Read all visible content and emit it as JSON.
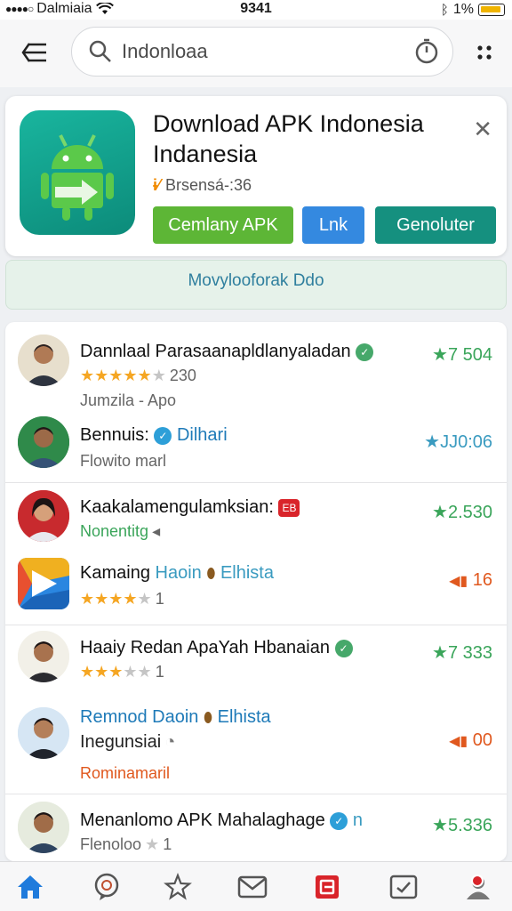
{
  "status_bar": {
    "carrier": "Dalmiaia",
    "time": "9341",
    "battery": "1%"
  },
  "search": {
    "value": "Indonloaa"
  },
  "featured": {
    "title": "Download APK Indonesia Indanesia",
    "meta": "Brsensá-:36",
    "buttons": {
      "primary": "Cemlany APK",
      "secondary": "Lnk",
      "tertiary": "Genoluter"
    },
    "colors": {
      "primary": "#5db636",
      "secondary": "#3489e0",
      "tertiary": "#15907f",
      "icon": "#19b59e"
    }
  },
  "banner": {
    "text": "Movylooforak Ddo"
  },
  "list": [
    {
      "title": "Dannlaal Parasaanapldlanyaladan",
      "stars": "★★★★★",
      "stars_off": "★",
      "rating_count": "230",
      "subtitle": "Jumzila - Apo",
      "value": "★7 504"
    },
    {
      "title": "Bennuis:",
      "title_accent": "Dilhari",
      "subtitle": "Flowito marl",
      "value": "★JJ0:06"
    },
    {
      "title": "Kaakalamengulamksian:",
      "tag": "EB",
      "subtitle": "Nonentitg",
      "value": "★2.530"
    },
    {
      "title": "Kamaing",
      "title_accent": "Haoin",
      "title_accent2": "Elhista",
      "stars": "★★★★",
      "stars_off": "★",
      "rating_count": "1",
      "value": "16"
    },
    {
      "title": "Haaiy Redan ApaYah Hbanaian",
      "stars": "★★★",
      "stars_off": "★★",
      "rating_count": "1",
      "value": "★7 333"
    },
    {
      "title": "Remnod Daoin",
      "title_accent2": "Elhista",
      "subtitle": "Inegunsiai",
      "subtitle2": "Rominamaril",
      "value": "00"
    },
    {
      "title": "Menanlomo APK Mahalaghage",
      "title_suffix": "n",
      "subtitle": "Flenoloo",
      "rating_count": "1",
      "value": "★5.336"
    }
  ]
}
